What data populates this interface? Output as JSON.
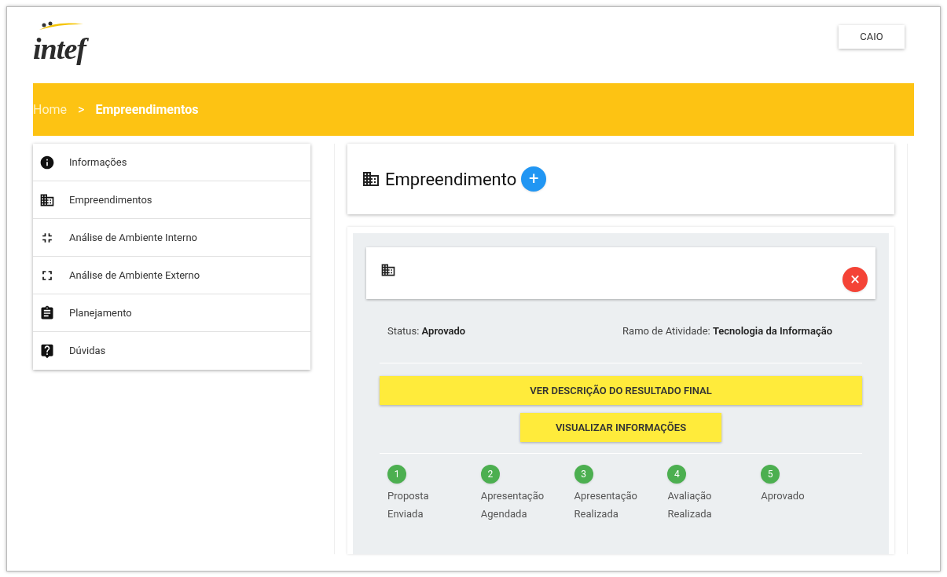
{
  "logo": "intef",
  "user_button": "CAIO",
  "breadcrumb": [
    {
      "label": "Home",
      "selected": false
    },
    {
      "label": "Empreendimentos",
      "selected": true
    }
  ],
  "breadcrumb_separator": ">",
  "sidebar": {
    "items": [
      {
        "label": "Informações"
      },
      {
        "label": "Empreendimentos"
      },
      {
        "label": "Análise de Ambiente Interno"
      },
      {
        "label": "Análise de Ambiente Externo"
      },
      {
        "label": "Planejamento"
      },
      {
        "label": "Dúvidas"
      }
    ]
  },
  "header_card": {
    "title": "Empreendimento",
    "add_button": "+"
  },
  "enterprise": {
    "close_button": "×",
    "status_label": "Status:",
    "status": "Aprovado",
    "activity_label": "Ramo de Atividade:",
    "activity": "Tecnologia da Informação",
    "buttons": [
      "VER DESCRIÇÃO DO RESULTADO FINAL",
      "VISUALIZAR INFORMAÇÕES"
    ],
    "steps": [
      {
        "number": "1",
        "lines": [
          "Proposta",
          "Enviada"
        ],
        "done": true
      },
      {
        "number": "2",
        "lines": [
          "Apresentação",
          "Agendada"
        ],
        "done": true
      },
      {
        "number": "3",
        "lines": [
          "Apresentação",
          "Realizada"
        ],
        "done": true
      },
      {
        "number": "4",
        "lines": [
          "Avaliação",
          "Realizada"
        ],
        "done": true
      },
      {
        "number": "5",
        "lines": [
          "Aprovado"
        ],
        "done": true
      }
    ]
  }
}
